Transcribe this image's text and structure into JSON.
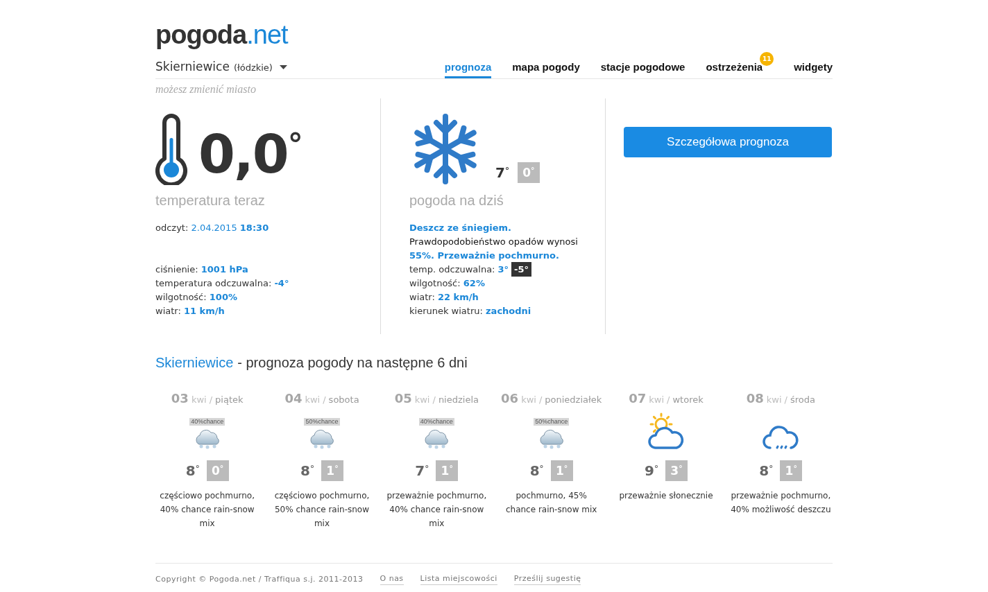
{
  "header": {
    "logo": {
      "name": "pogoda",
      "suffix": ".net"
    },
    "location": {
      "city": "Skierniewice",
      "region": "(łódzkie)",
      "hint": "możesz zmienić miasto"
    },
    "nav": [
      {
        "label": "prognoza",
        "selected": true
      },
      {
        "label": "mapa pogody",
        "selected": false
      },
      {
        "label": "stacje pogodowe",
        "selected": false
      },
      {
        "label": "ostrzeżenia",
        "selected": false,
        "badge": "11"
      },
      {
        "label": "widgety",
        "selected": false
      }
    ]
  },
  "current": {
    "temperature": "0,0$^{°}$",
    "caption": "temperatura teraz",
    "reading": {
      "label": "odczyt:",
      "date": "2.04.2015",
      "time": "18:30"
    },
    "details": [
      {
        "label": "ciśnienie:",
        "value": "1001 hPa"
      },
      {
        "label": "temperatura odczuwalna:",
        "value": "-4°"
      },
      {
        "label": "wilgotność:",
        "value": "100%"
      },
      {
        "label": "wiatr:",
        "value": "11 km/h"
      }
    ]
  },
  "today": {
    "high": "7$^{°}$",
    "low": "0$^{°}$",
    "caption": "pogoda na dziś",
    "summary": "Deszcz ze śniegiem.",
    "description": "Prawdopodobieństwo opadów wynosi **55%. Przeważnie pochmurno.**",
    "feels_like": {
      "label": "temp. odczuwalna:",
      "value": "3°",
      "night": "-5°"
    },
    "details": [
      {
        "label": "wilgotność:",
        "value": "62%"
      },
      {
        "label": "wiatr:",
        "value": "22 km/h"
      },
      {
        "label": "kierunek wiatru:",
        "value": "zachodni"
      }
    ]
  },
  "detail_button": "Szczegółowa prognoza",
  "forecast": {
    "city": "Skierniewice",
    "title": "- prognoza pogody na następne 6 dni",
    "days": [
      {
        "day": "03",
        "month": "kwi",
        "separator": "/",
        "weekday": "piątek",
        "kind": "rain-snow",
        "chance": "40%chance",
        "high": "8$^{°}$",
        "low": "0$^{°}$",
        "description": "częściowo pochmurno, 40% chance rain-snow mix"
      },
      {
        "day": "04",
        "month": "kwi",
        "separator": "/",
        "weekday": "sobota",
        "kind": "rain-snow",
        "chance": "50%chance",
        "high": "8$^{°}$",
        "low": "1$^{°}$",
        "description": "częściowo pochmurno, 50% chance rain-snow mix"
      },
      {
        "day": "05",
        "month": "kwi",
        "separator": "/",
        "weekday": "niedziela",
        "kind": "rain-snow",
        "chance": "40%chance",
        "high": "7$^{°}$",
        "low": "1$^{°}$",
        "description": "przeważnie pochmurno, 40% chance rain-snow mix"
      },
      {
        "day": "06",
        "month": "kwi",
        "separator": "/",
        "weekday": "poniedziałek",
        "kind": "rain-snow",
        "chance": "50%chance",
        "high": "8$^{°}$",
        "low": "1$^{°}$",
        "description": "pochmurno, 45% chance rain-snow mix"
      },
      {
        "day": "07",
        "month": "kwi",
        "separator": "/",
        "weekday": "wtorek",
        "kind": "sun-cloud",
        "high": "9$^{°}$",
        "low": "3$^{°}$",
        "description": "przeważnie słonecznie"
      },
      {
        "day": "08",
        "month": "kwi",
        "separator": "/",
        "weekday": "środa",
        "kind": "rain-cloud",
        "high": "8$^{°}$",
        "low": "1$^{°}$",
        "description": "przeważnie pochmurno, 40% możliwość deszczu"
      }
    ]
  },
  "footer": {
    "copyright": "Copyright © Pogoda.net / Traffiqua s.j. 2011-2013",
    "links": [
      "O nas",
      "Lista miejscowości",
      "Prześlij sugestię"
    ]
  }
}
